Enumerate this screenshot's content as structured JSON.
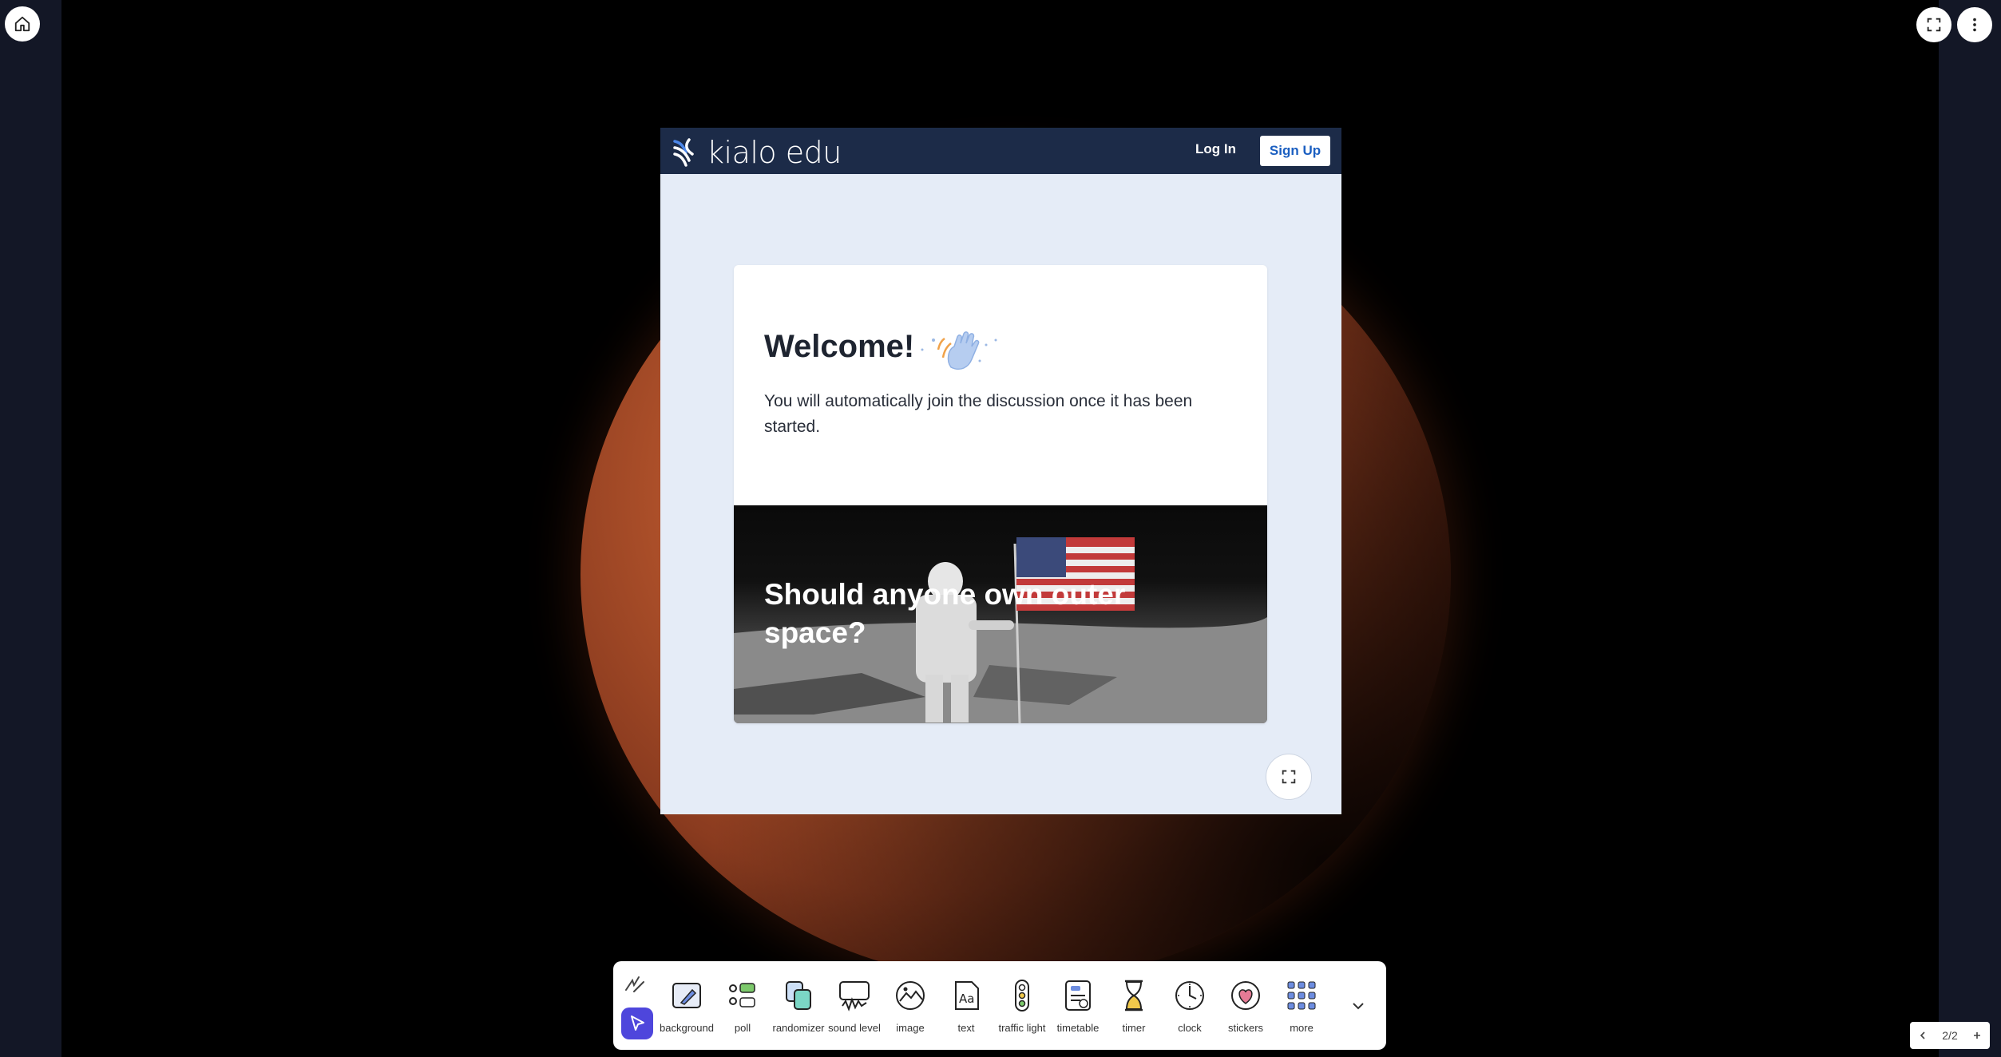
{
  "app": {
    "header": {
      "brand": "kialo edu",
      "login_label": "Log In",
      "signup_label": "Sign Up"
    },
    "card": {
      "welcome": "Welcome!",
      "description": "You will automatically join the discussion once it has been started.",
      "topic": "Should anyone own outer space?"
    }
  },
  "corner_buttons": {
    "home_icon": "home-icon",
    "fullscreen_icon": "fullscreen-icon",
    "menu_icon": "more-vertical-icon"
  },
  "toolbar": {
    "tools": [
      {
        "label": "background",
        "icon": "background-icon"
      },
      {
        "label": "poll",
        "icon": "poll-icon"
      },
      {
        "label": "randomizer",
        "icon": "randomizer-icon"
      },
      {
        "label": "sound level",
        "icon": "sound-level-icon"
      },
      {
        "label": "image",
        "icon": "image-icon"
      },
      {
        "label": "text",
        "icon": "text-icon"
      },
      {
        "label": "traffic light",
        "icon": "traffic-light-icon"
      },
      {
        "label": "timetable",
        "icon": "timetable-icon"
      },
      {
        "label": "timer",
        "icon": "timer-icon"
      },
      {
        "label": "clock",
        "icon": "clock-icon"
      },
      {
        "label": "stickers",
        "icon": "stickers-icon"
      },
      {
        "label": "more",
        "icon": "more-grid-icon"
      }
    ]
  },
  "pager": {
    "page_display": "2/2"
  },
  "colors": {
    "header_bg": "#1c2b48",
    "accent": "#4e46dc",
    "signup_text": "#1b5fc1"
  }
}
